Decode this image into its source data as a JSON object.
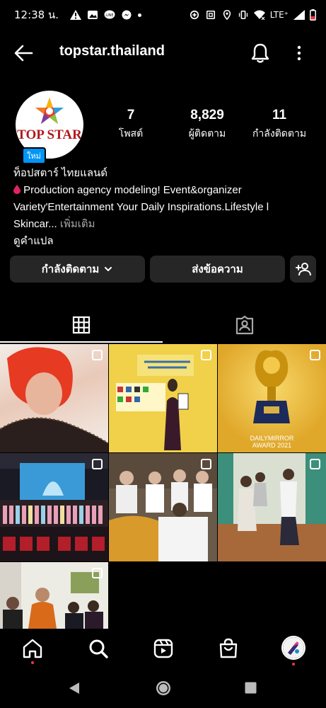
{
  "status_bar": {
    "time": "12:38 น.",
    "network": "LTE⁺"
  },
  "header": {
    "username": "topstar.thailand"
  },
  "profile": {
    "avatar_text": "TOP STAR",
    "new_badge": "ใหม่",
    "stats": [
      {
        "value": "7",
        "label": "โพสต์"
      },
      {
        "value": "8,829",
        "label": "ผู้ติดตาม"
      },
      {
        "value": "11",
        "label": "กำลังติดตาม"
      }
    ],
    "display_name": "ท็อปสตาร์ ไทยแลนด์",
    "bio_line1": " Production agency modeling!  Event&organizer",
    "bio_line2": " Variety'Entertainment Your Daily Inspirations.Lifestyle l",
    "bio_line3": "Skincar...",
    "more": " เพิ่มเติม",
    "translate": "ดูคำแปล"
  },
  "buttons": {
    "following": "กำลังติดตาม",
    "message": "ส่งข้อความ"
  },
  "grid": {
    "award_caption_1": "DAILYMIRROR",
    "award_caption_2": "AWARD 2021"
  },
  "colors": {
    "accent": "#0095f6",
    "button_bg": "#262626",
    "notification_dot": "#ff3040",
    "drop_red": "#e0245e"
  },
  "icons": [
    "back-arrow-icon",
    "bell-icon",
    "more-vertical-icon",
    "chevron-down-icon",
    "add-person-icon",
    "grid-icon",
    "tagged-icon",
    "home-icon",
    "search-icon",
    "reels-icon",
    "shop-icon",
    "profile-icon"
  ]
}
